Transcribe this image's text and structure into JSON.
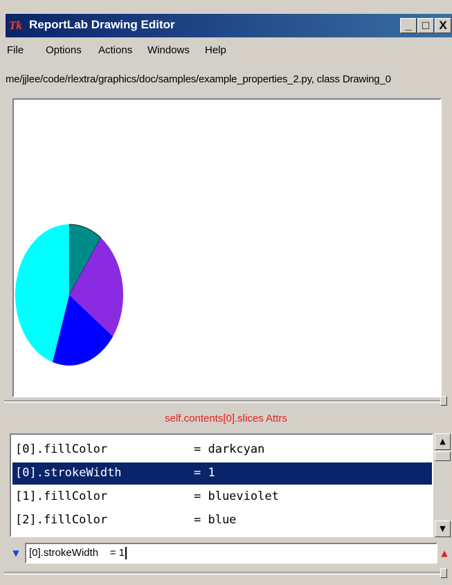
{
  "window": {
    "title": "ReportLab Drawing Editor",
    "icon_text": "Tk",
    "controls": [
      "_",
      "□",
      "X"
    ]
  },
  "menu": [
    {
      "label": "File"
    },
    {
      "label": "Options"
    },
    {
      "label": "Actions"
    },
    {
      "label": "Windows"
    },
    {
      "label": "Help"
    }
  ],
  "path": "me/jjlee/code/rlextra/graphics/doc/samples/example_properties_2.py, class Drawing_0",
  "pie_slices": [
    {
      "fill": "#008b8b",
      "stroke": true,
      "share": 0.1
    },
    {
      "fill": "#8a2be2",
      "stroke": false,
      "share": 0.25
    },
    {
      "fill": "#0000ff",
      "stroke": false,
      "share": 0.2
    },
    {
      "fill": "#00ffff",
      "stroke": false,
      "share": 0.45
    }
  ],
  "attrs_label": "self.contents[0].slices Attrs",
  "attrs": [
    {
      "key": "[0].fillColor",
      "value": "= darkcyan",
      "selected": false
    },
    {
      "key": "[0].strokeWidth",
      "value": "= 1",
      "selected": true
    },
    {
      "key": "[1].fillColor",
      "value": "= blueviolet",
      "selected": false
    },
    {
      "key": "[2].fillColor",
      "value": "= blue",
      "selected": false
    }
  ],
  "edit_value": "[0].strokeWidth    = 1",
  "colors": {
    "accent_red": "#e02020",
    "selection": "#0a246a"
  }
}
